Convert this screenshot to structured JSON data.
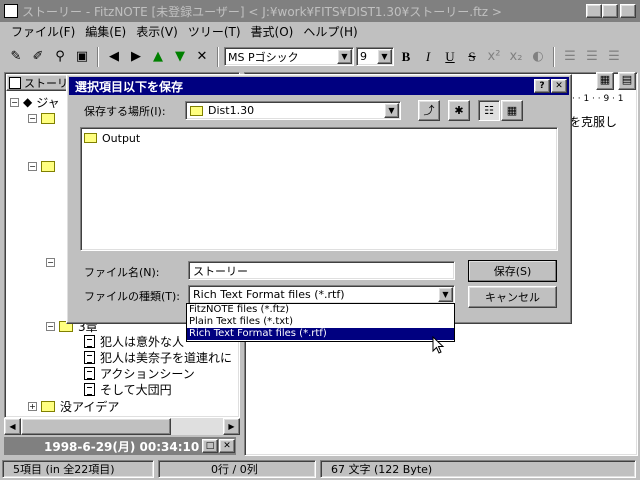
{
  "app": {
    "title": "ストーリー - FitzNOTE [未登録ユーザー] < J:¥work¥FITS¥DIST1.30¥ストーリー.ftz >"
  },
  "menu": [
    "ファイル(F)",
    "編集(E)",
    "表示(V)",
    "ツリー(T)",
    "書式(O)",
    "ヘルプ(H)"
  ],
  "toolbar": {
    "font": "MS Pゴシック",
    "size": "9",
    "bold": "B",
    "italic": "I",
    "underline": "U",
    "strike": "S"
  },
  "tree": {
    "header": "ストーリ",
    "root": "ジャ",
    "items": [
      "3章",
      "犯人は意外な人",
      "犯人は美奈子を道連れに",
      "アクションシーン",
      "そして大団円",
      "没アイデア"
    ]
  },
  "editor": {
    "visible_text": "を克服し",
    "ruler": "· · 1 · · 9 · 1"
  },
  "date_status": "1998-6-29(月) 00:34:10",
  "status": {
    "items": "5項目 (in 全22項目)",
    "position": "0行 / 0列",
    "chars": "67 文字 (122 Byte)"
  },
  "dialog": {
    "title": "選択項目以下を保存",
    "save_in_label": "保存する場所(I):",
    "save_in_value": "Dist1.30",
    "folders": [
      "Output"
    ],
    "filename_label": "ファイル名(N):",
    "filename_value": "ストーリー",
    "filetype_label": "ファイルの種類(T):",
    "filetype_value": "Rich Text Format files (*.rtf)",
    "save_button": "保存(S)",
    "cancel_button": "キャンセル",
    "filetype_options": [
      "FitzNOTE files (*.ftz)",
      "Plain Text files (*.txt)",
      "Rich Text Format files (*.rtf)"
    ],
    "selected_option": 2
  },
  "colors": {
    "dialog_title_bg": "#000080",
    "selection": "#000080",
    "chrome": "#c0c0c0"
  }
}
